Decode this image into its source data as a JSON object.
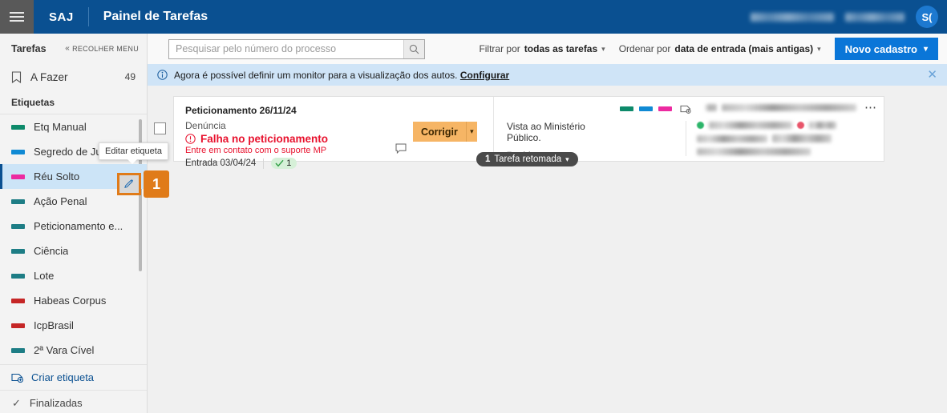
{
  "header": {
    "menu_icon": "hamburger-icon",
    "brand": "SAJ",
    "title": "Painel de Tarefas",
    "avatar_initials": "S(",
    "redacted_items": [
      "",
      ""
    ]
  },
  "sidebar": {
    "title": "Tarefas",
    "collapse_label": "RECOLHER MENU",
    "collapse_icon": "chevron-double-left-icon",
    "todo": {
      "icon": "bookmark-icon",
      "label": "A Fazer",
      "count": "49"
    },
    "labels_header": "Etiquetas",
    "labels": [
      {
        "name": "Etq Manual",
        "color": "#0d8a6a"
      },
      {
        "name": "Segredo de Justi...",
        "color": "#108ad4"
      },
      {
        "name": "Réu Solto",
        "color": "#ec2aa0",
        "selected": true
      },
      {
        "name": "Ação Penal",
        "color": "#1d7d85"
      },
      {
        "name": "Peticionamento e...",
        "color": "#1d7d85"
      },
      {
        "name": "Ciência",
        "color": "#1d7d85"
      },
      {
        "name": "Lote",
        "color": "#1d7d85"
      },
      {
        "name": "Habeas Corpus",
        "color": "#c52626"
      },
      {
        "name": "IcpBrasil",
        "color": "#c52626"
      },
      {
        "name": "2ª Vara Cível",
        "color": "#1d7d85"
      }
    ],
    "create_label": {
      "icon": "add-tag-icon",
      "label": "Criar etiqueta"
    },
    "finished": {
      "icon": "check-icon",
      "label": "Finalizadas"
    }
  },
  "tooltip": {
    "text": "Editar etiqueta"
  },
  "edit_button": {
    "icon": "pencil-icon"
  },
  "step_badge": {
    "number": "1",
    "color": "#e07b19"
  },
  "toolbar": {
    "search_placeholder": "Pesquisar pelo número do processo",
    "search_value": "",
    "search_icon": "search-icon",
    "filter_prefix": "Filtrar por",
    "filter_value": "todas as tarefas",
    "sort_prefix": "Ordenar por",
    "sort_value": "data de entrada (mais antigas)",
    "new_button": "Novo cadastro",
    "chevron_icon": "chevron-down-icon"
  },
  "banner": {
    "icon": "info-icon",
    "text": "Agora é possível definir um monitor para a visualização dos autos.",
    "link": "Configurar",
    "close_icon": "close-icon"
  },
  "card": {
    "checkbox_checked": false,
    "title": "Peticionamento 26/11/24",
    "subtitle": "Denúncia",
    "error_icon": "error-circle-icon",
    "error_title": "Falha no peticionamento",
    "error_sub": "Entre em contato com o suporte MP",
    "entrada": "Entrada 03/04/24",
    "check_badge_count": "1",
    "comment_icon": "comment-icon",
    "action_button": "Corrigir",
    "action_chevron": "chevron-down-icon",
    "vista_text": "Vista ao Ministério Público.",
    "ver_autos": "Ver autos",
    "folder_icon": "folder-icon",
    "chips": [
      "#0d8a6a",
      "#108ad4",
      "#ec2aa0"
    ],
    "tag_add_icon": "add-tag-icon",
    "more_icon": "more-options-icon",
    "party_dots": [
      "#2db56a",
      "#e8556a"
    ],
    "retomada_count": "1",
    "retomada_label": "Tarefa retomada"
  }
}
